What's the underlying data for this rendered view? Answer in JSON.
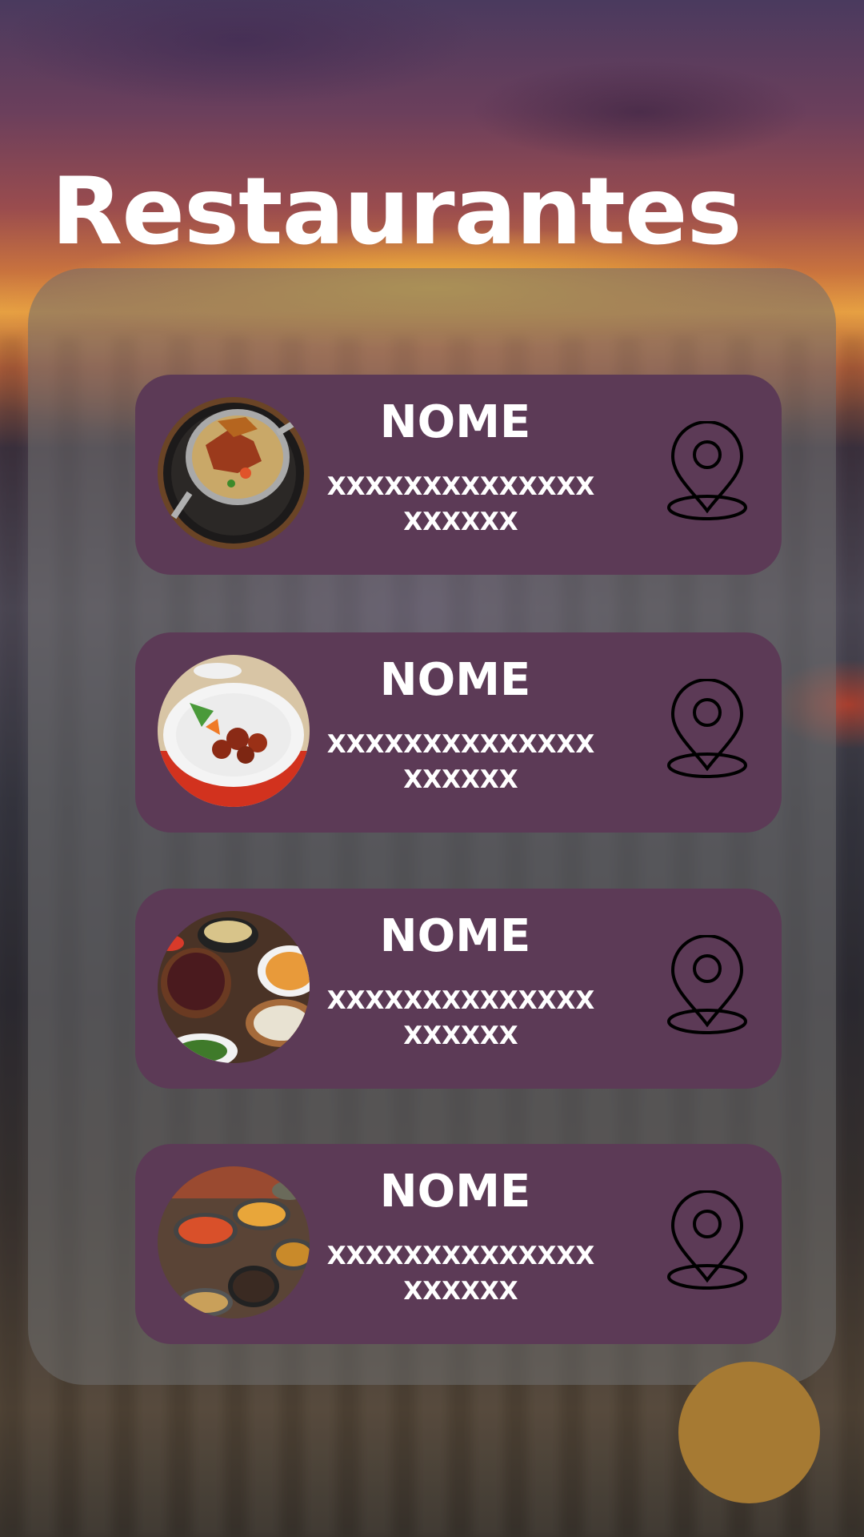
{
  "page": {
    "title": "Restaurantes"
  },
  "restaurants": [
    {
      "name": "NOME",
      "address": "XXXXXXXXXXXXXXXXXXXX",
      "photo": "food-skillet-dish",
      "action_icon": "location-pin-icon"
    },
    {
      "name": "NOME",
      "address": "XXXXXXXXXXXXXXXXXXXX",
      "photo": "food-chicken-plate",
      "action_icon": "location-pin-icon"
    },
    {
      "name": "NOME",
      "address": "XXXXXXXXXXXXXXXXXXXX",
      "photo": "food-bowls-spread",
      "action_icon": "location-pin-icon"
    },
    {
      "name": "NOME",
      "address": "XXXXXXXXXXXXXXXXXXXX",
      "photo": "food-buffet-table",
      "action_icon": "location-pin-icon"
    }
  ],
  "colors": {
    "card": "#5c3a56",
    "panel": "rgba(110,110,110,0.55)",
    "fab": "#a67a33",
    "title": "#ffffff"
  }
}
